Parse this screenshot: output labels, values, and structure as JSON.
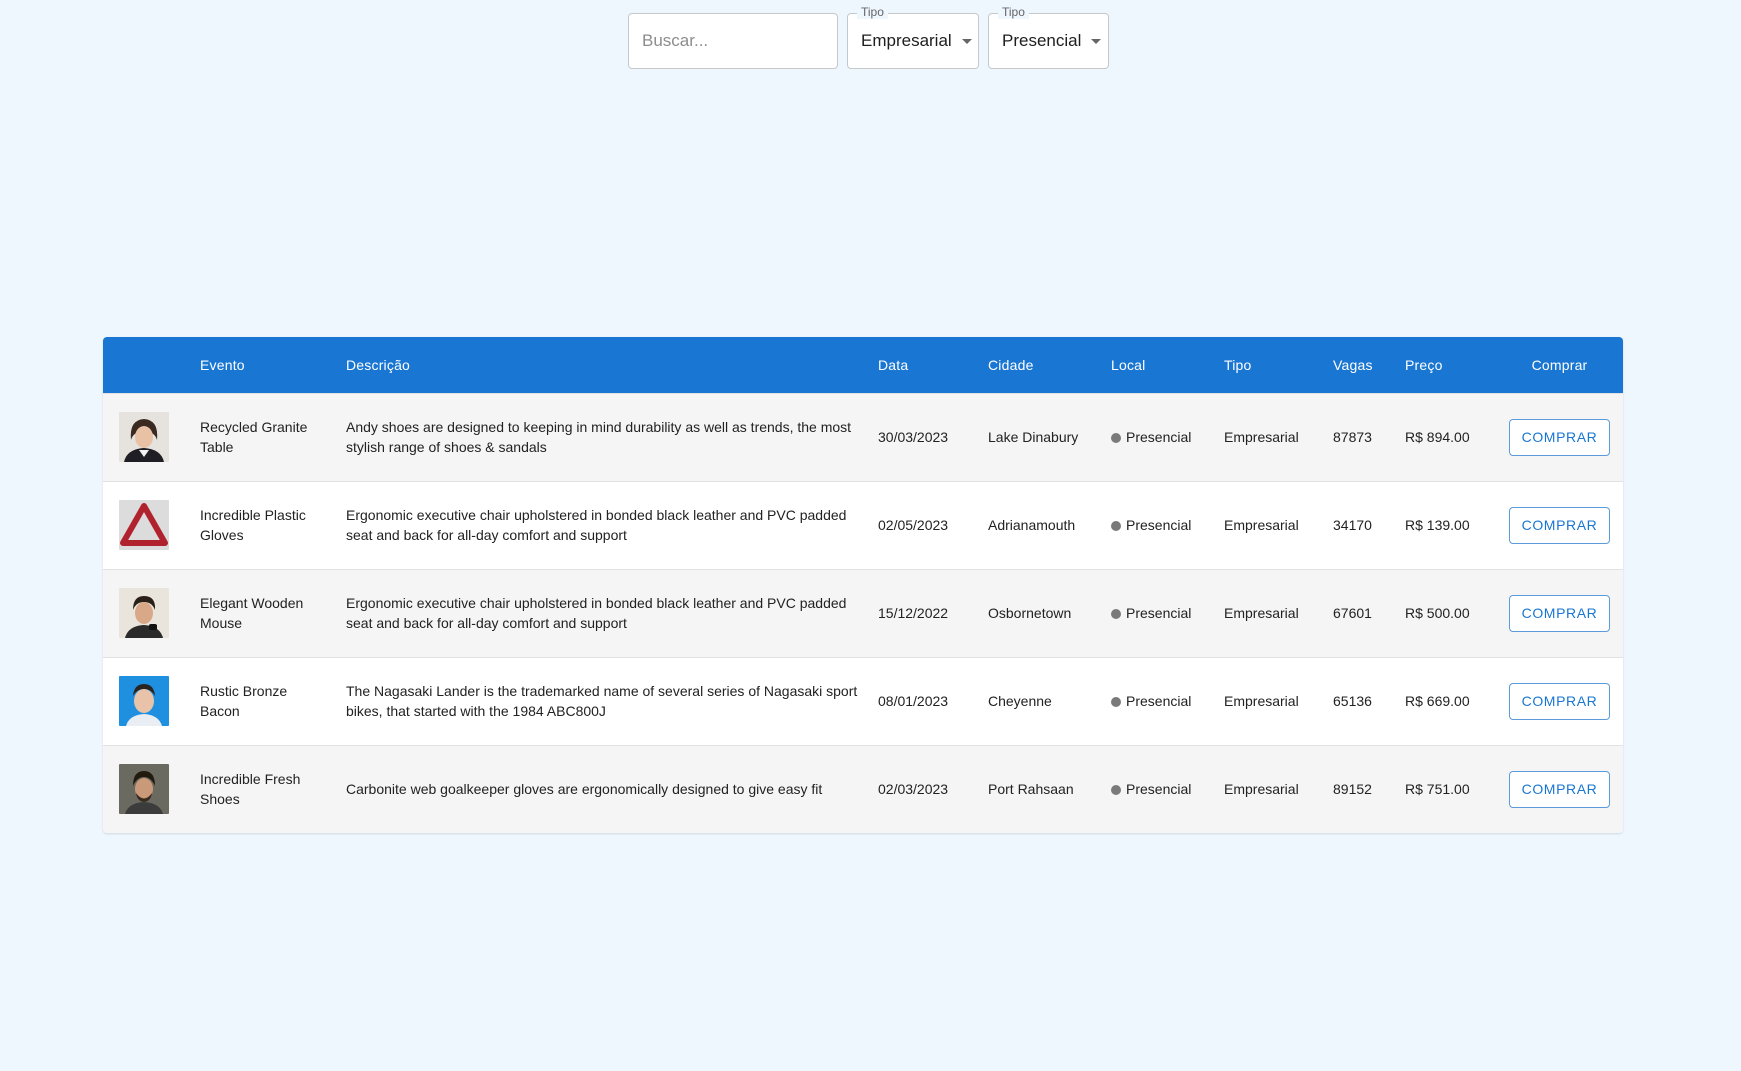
{
  "filters": {
    "search_placeholder": "Buscar...",
    "tipo1": {
      "label": "Tipo",
      "value": "Empresarial"
    },
    "tipo2": {
      "label": "Tipo",
      "value": "Presencial"
    }
  },
  "table": {
    "headers": {
      "evento": "Evento",
      "descricao": "Descrição",
      "data": "Data",
      "cidade": "Cidade",
      "local": "Local",
      "tipo": "Tipo",
      "vagas": "Vagas",
      "preco": "Preço",
      "comprar": "Comprar"
    },
    "rows": [
      {
        "image": "avatar-woman-icon",
        "evento": "Recycled Granite Table",
        "descricao": "Andy shoes are designed to keeping in mind durability as well as trends, the most stylish range of shoes & sandals",
        "data": "30/03/2023",
        "cidade": "Lake Dinabury",
        "local": "Presencial",
        "tipo": "Empresarial",
        "vagas": "87873",
        "preco": "R$ 894.00",
        "button": "COMPRAR"
      },
      {
        "image": "warning-triangle-icon",
        "evento": "Incredible Plastic Gloves",
        "descricao": "Ergonomic executive chair upholstered in bonded black leather and PVC padded seat and back for all-day comfort and support",
        "data": "02/05/2023",
        "cidade": "Adrianamouth",
        "local": "Presencial",
        "tipo": "Empresarial",
        "vagas": "34170",
        "preco": "R$ 139.00",
        "button": "COMPRAR"
      },
      {
        "image": "avatar-man-icon",
        "evento": "Elegant Wooden Mouse",
        "descricao": "Ergonomic executive chair upholstered in bonded black leather and PVC padded seat and back for all-day comfort and support",
        "data": "15/12/2022",
        "cidade": "Osbornetown",
        "local": "Presencial",
        "tipo": "Empresarial",
        "vagas": "67601",
        "preco": "R$ 500.00",
        "button": "COMPRAR"
      },
      {
        "image": "avatar-man-blue-icon",
        "evento": "Rustic Bronze Bacon",
        "descricao": "The Nagasaki Lander is the trademarked name of several series of Nagasaki sport bikes, that started with the 1984 ABC800J",
        "data": "08/01/2023",
        "cidade": "Cheyenne",
        "local": "Presencial",
        "tipo": "Empresarial",
        "vagas": "65136",
        "preco": "R$ 669.00",
        "button": "COMPRAR"
      },
      {
        "image": "avatar-man-beard-icon",
        "evento": "Incredible Fresh Shoes",
        "descricao": "Carbonite web goalkeeper gloves are ergonomically designed to give easy fit",
        "data": "02/03/2023",
        "cidade": "Port Rahsaan",
        "local": "Presencial",
        "tipo": "Empresarial",
        "vagas": "89152",
        "preco": "R$ 751.00",
        "button": "COMPRAR"
      }
    ]
  },
  "colors": {
    "header": "#1976d2",
    "page_bg": "#eef6fe",
    "status_dot": "#7a7a7a"
  }
}
